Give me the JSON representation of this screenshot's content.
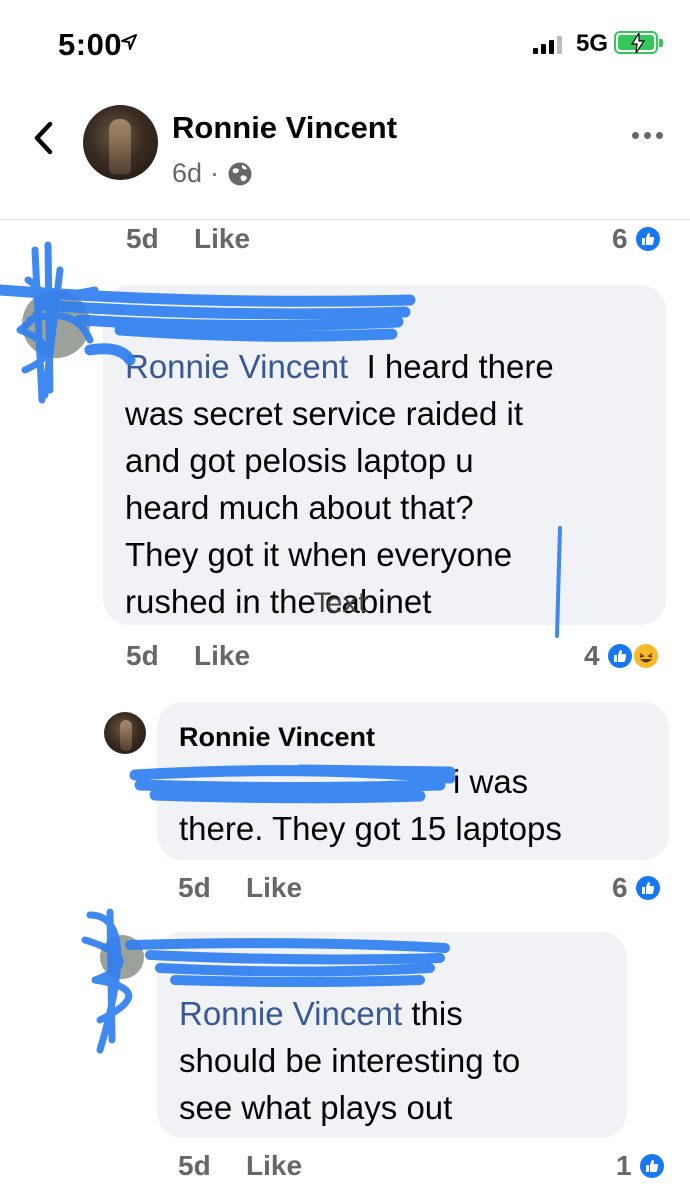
{
  "status_bar": {
    "time": "5:00",
    "network": "5G",
    "battery_state": "charging"
  },
  "header": {
    "author": "Ronnie Vincent",
    "age": "6d",
    "separator": "·",
    "privacy_icon": "globe-icon"
  },
  "comments": [
    {
      "time": "5d",
      "like_label": "Like",
      "reaction_count": "6",
      "reactions": [
        "like"
      ]
    },
    {
      "mention": "Ronnie Vincent",
      "text_line1": "I heard there",
      "text_lines": [
        "was secret service raided it",
        "and got pelosis laptop u",
        "heard much about that?",
        "They got it when everyone"
      ],
      "last_line": "rushed in the cabinet",
      "overlay_text": "Text",
      "time": "5d",
      "like_label": "Like",
      "reaction_count": "4",
      "reactions": [
        "like",
        "haha"
      ]
    },
    {
      "name": "Ronnie Vincent",
      "line1": "i was",
      "line2": "there. They got 15 laptops",
      "time": "5d",
      "like_label": "Like",
      "reaction_count": "6",
      "reactions": [
        "like"
      ]
    },
    {
      "mention": "Ronnie Vincent",
      "text_line1": "this",
      "line2": "should be interesting to",
      "line3": "see what plays out",
      "time": "5d",
      "like_label": "Like",
      "reaction_count": "1",
      "reactions": [
        "like"
      ]
    }
  ],
  "colors": {
    "mention": "#385898",
    "bubble": "#f0f2f5",
    "meta": "#65676b",
    "like_blue": "#1877f2",
    "scribble": "#2f7ff0"
  }
}
